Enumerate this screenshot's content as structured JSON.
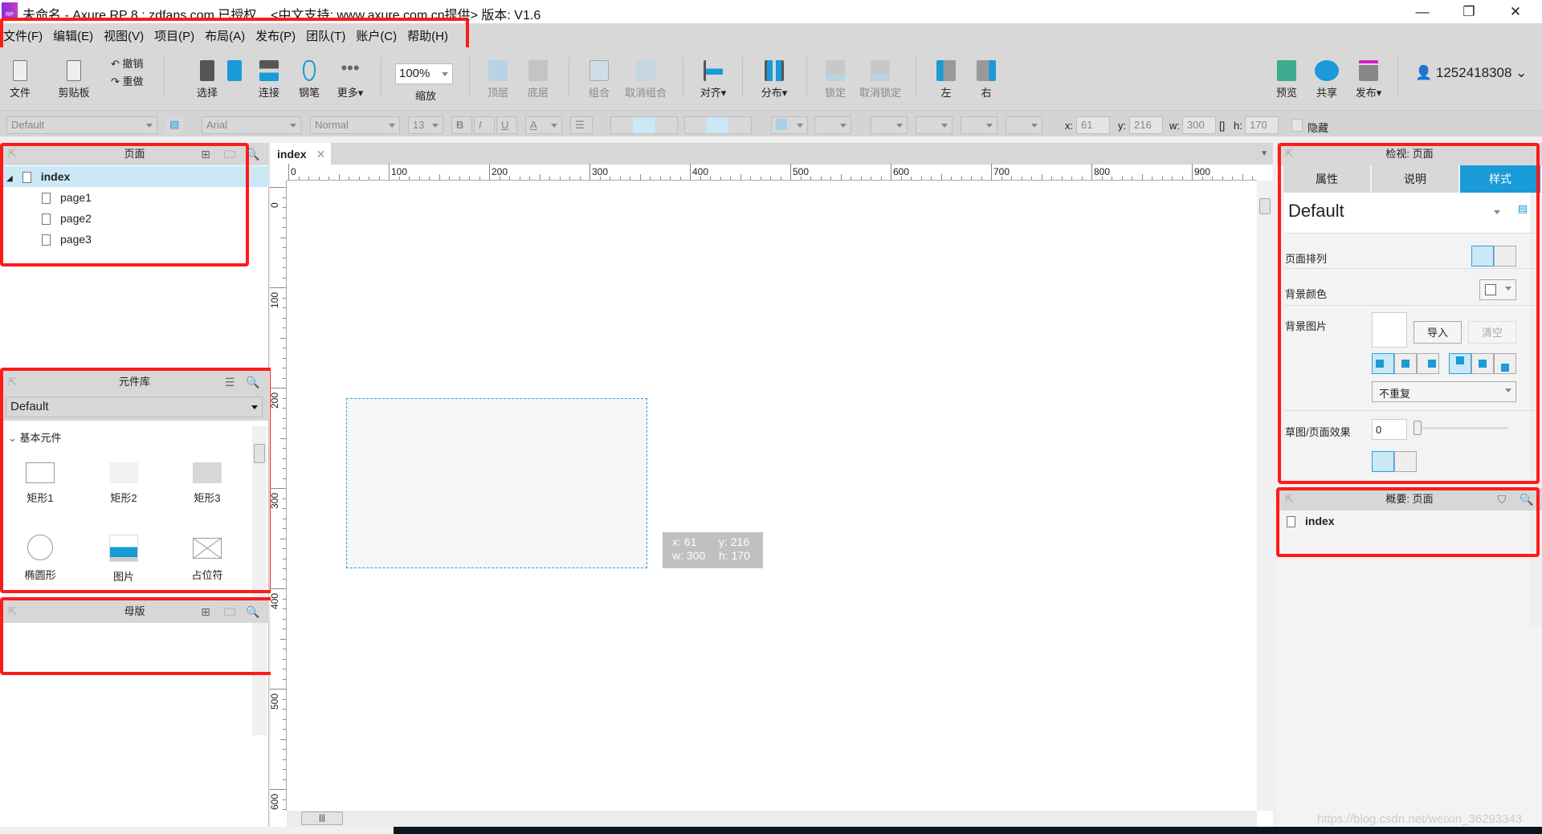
{
  "window": {
    "title": "未命名 - Axure RP 8 : zdfans.com 已授权    <中文支持: www.axure.com.cn提供> 版本: V1.6",
    "logo_text": "RP",
    "controls": [
      "—",
      "❐",
      "✕"
    ]
  },
  "menu": [
    "文件(F)",
    "编辑(E)",
    "视图(V)",
    "项目(P)",
    "布局(A)",
    "发布(P)",
    "团队(T)",
    "账户(C)",
    "帮助(H)"
  ],
  "toolbar": {
    "file": "文件",
    "clipboard": "剪贴板",
    "undo": "撤销",
    "redo": "重做",
    "select": "选择",
    "connect": "连接",
    "pen": "钢笔",
    "more": "更多▾",
    "zoom_value": "100%",
    "zoom_label": "缩放",
    "top": "顶层",
    "bottom": "底层",
    "group": "组合",
    "ungroup": "取消组合",
    "align": "对齐▾",
    "distribute": "分布▾",
    "lock": "锁定",
    "unlock": "取消锁定",
    "left": "左",
    "right": "右",
    "preview": "预览",
    "share": "共享",
    "publish": "发布▾",
    "user": "1252418308"
  },
  "format": {
    "style": "Default",
    "font": "Arial",
    "weight": "Normal",
    "size": "13",
    "bold": "B",
    "italic": "I",
    "underline": "U",
    "font_color": "A",
    "x_label": "x:",
    "x": "61",
    "y_label": "y:",
    "y": "216",
    "w_label": "w:",
    "w": "300",
    "h_label": "h:",
    "h": "170",
    "hide_label": "隐藏"
  },
  "pages": {
    "title": "页面",
    "root": "index",
    "children": [
      "page1",
      "page2",
      "page3"
    ]
  },
  "library": {
    "title": "元件库",
    "selected": "Default",
    "group": "基本元件",
    "widgets": [
      "矩形1",
      "矩形2",
      "矩形3",
      "椭圆形",
      "图片",
      "占位符"
    ]
  },
  "masters": {
    "title": "母版"
  },
  "canvas": {
    "tab": "index",
    "ruler_h": [
      "0",
      "100",
      "200",
      "300",
      "400",
      "500",
      "600",
      "700",
      "800",
      "900"
    ],
    "ruler_v": [
      "0",
      "100",
      "200",
      "300",
      "400",
      "500",
      "600"
    ],
    "tooltip": {
      "x": "x: 61",
      "y": "y: 216",
      "w": "w: 300",
      "h": "h: 170"
    }
  },
  "inspector": {
    "title": "检视: 页面",
    "tabs": [
      "属性",
      "说明",
      "样式"
    ],
    "active_tab": "样式",
    "style": "Default",
    "page_align": "页面排列",
    "bg_color": "背景颜色",
    "bg_image": "背景图片",
    "import": "导入",
    "clear": "清空",
    "repeat": "不重复",
    "sketch": "草图/页面效果",
    "sketch_value": "0"
  },
  "outline": {
    "title": "概要: 页面",
    "item": "index"
  },
  "watermark": "https://blog.csdn.net/weixin_36293343",
  "colors": {
    "accent": "#1a9ad6",
    "highlight": "#cbe8f7",
    "annotation": "#ff1a1a"
  }
}
